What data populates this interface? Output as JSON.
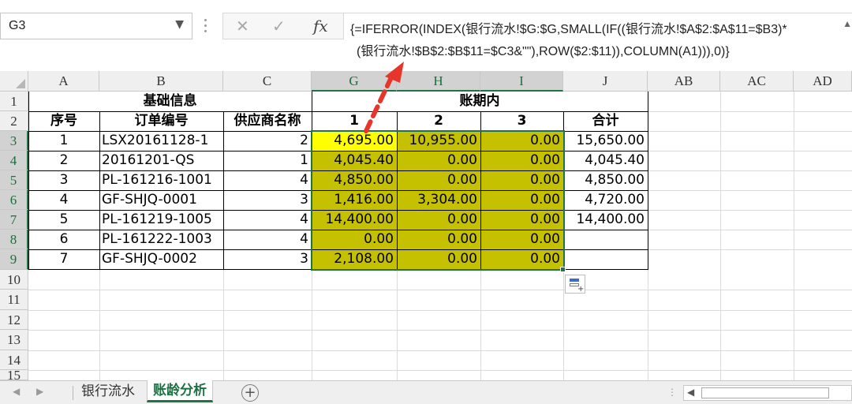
{
  "formula_bar": {
    "name_box": "G3",
    "formula_line1": "{=IFERROR(INDEX(银行流水!$G:$G,SMALL(IF((银行流水!$A$2:$A$11=$B3)*",
    "formula_line2": "(银行流水!$B$2:$B$11=$C3&\"\"),ROW($2:$11)),COLUMN(A1))),0)}",
    "buttons": {
      "cancel": "✕",
      "enter": "✓",
      "function": "fx"
    }
  },
  "columns": [
    "A",
    "B",
    "C",
    "G",
    "H",
    "I",
    "J",
    "AB",
    "AC",
    "AD"
  ],
  "rows": [
    "1",
    "2",
    "3",
    "4",
    "5",
    "6",
    "7",
    "8",
    "9",
    "10",
    "11",
    "12",
    "13",
    "14",
    "15"
  ],
  "header": {
    "basic_info": "基础信息",
    "in_period": "账期内",
    "seq": "序号",
    "order_no": "订单编号",
    "supplier": "供应商名称",
    "p1": "1",
    "p2": "2",
    "p3": "3",
    "total": "合计"
  },
  "table": {
    "rows": [
      {
        "seq": "1",
        "order": "LSX20161128-1",
        "supplier": "2",
        "g": "4,695.00",
        "h": "10,955.00",
        "i": "0.00",
        "total": "15,650.00"
      },
      {
        "seq": "2",
        "order": "20161201-QS",
        "supplier": "1",
        "g": "4,045.40",
        "h": "0.00",
        "i": "0.00",
        "total": "4,045.40"
      },
      {
        "seq": "3",
        "order": "PL-161216-1001",
        "supplier": "4",
        "g": "4,850.00",
        "h": "0.00",
        "i": "0.00",
        "total": "4,850.00"
      },
      {
        "seq": "4",
        "order": "GF-SHJQ-0001",
        "supplier": "3",
        "g": "1,416.00",
        "h": "3,304.00",
        "i": "0.00",
        "total": "4,720.00"
      },
      {
        "seq": "5",
        "order": "PL-161219-1005",
        "supplier": "4",
        "g": "14,400.00",
        "h": "0.00",
        "i": "0.00",
        "total": "14,400.00"
      },
      {
        "seq": "6",
        "order": "PL-161222-1003",
        "supplier": "4",
        "g": "0.00",
        "h": "0.00",
        "i": "0.00",
        "total": ""
      },
      {
        "seq": "7",
        "order": "GF-SHJQ-0002",
        "supplier": "3",
        "g": "2,108.00",
        "h": "0.00",
        "i": "0.00",
        "total": ""
      }
    ]
  },
  "sheet_tabs": [
    {
      "label": "银行流水",
      "active": false
    },
    {
      "label": "账龄分析",
      "active": true
    }
  ],
  "colors": {
    "selection": "#217346",
    "olive_fill": "#c5c000",
    "active_cell_fill": "#ffff00",
    "arrow": "#e8352c"
  }
}
